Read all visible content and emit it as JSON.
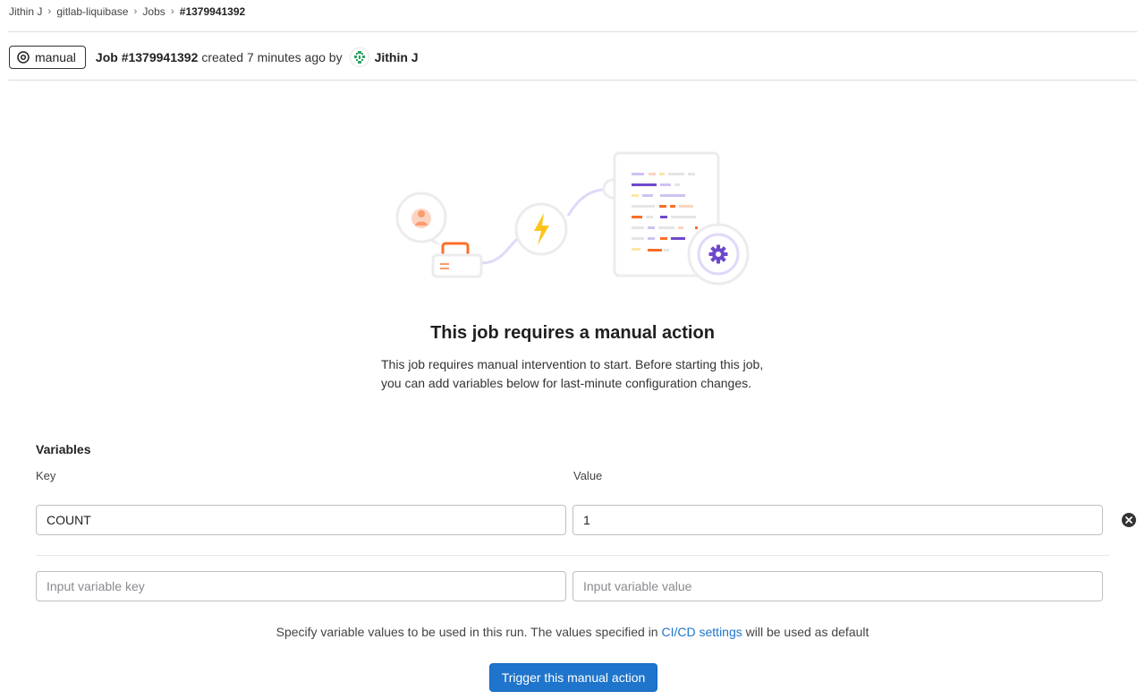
{
  "breadcrumb": {
    "items": [
      "Jithin J",
      "gitlab-liquibase",
      "Jobs",
      "#1379941392"
    ]
  },
  "job": {
    "status": "manual",
    "title": "Job #1379941392",
    "created_text": "created 7 minutes ago by",
    "author": "Jithin J"
  },
  "empty_state": {
    "title": "This job requires a manual action",
    "description": "This job requires manual intervention to start. Before starting this job, you can add variables below for last-minute configuration changes."
  },
  "variables": {
    "heading": "Variables",
    "key_label": "Key",
    "value_label": "Value",
    "rows": [
      {
        "key": "COUNT",
        "value": "1"
      }
    ],
    "key_placeholder": "Input variable key",
    "value_placeholder": "Input variable value"
  },
  "help": {
    "before": "Specify variable values to be used in this run. The values specified in ",
    "link": "CI/CD settings",
    "after": " will be used as default"
  },
  "trigger_button": "Trigger this manual action",
  "colors": {
    "primary": "#1f75cb",
    "illustration_purple": "#6e49cb",
    "illustration_orange": "#fc6d26",
    "illustration_yellow": "#fdc51b"
  }
}
